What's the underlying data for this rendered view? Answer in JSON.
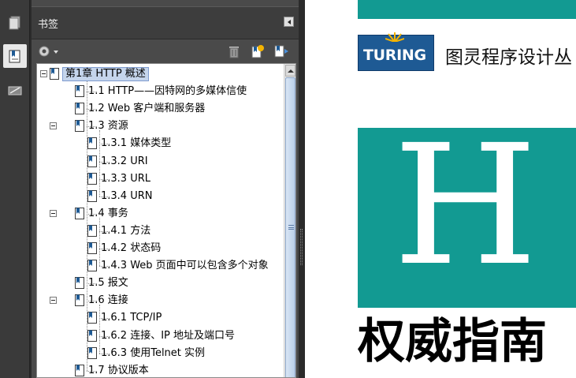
{
  "panel": {
    "title": "书签"
  },
  "toolbar": {
    "options_icon": "gear-icon",
    "delete_icon": "trash-icon",
    "new_bookmark_icon": "new-bookmark-icon",
    "expand_icon": "expand-bookmark-icon"
  },
  "bookmarks": [
    {
      "label": "第1章 HTTP 概述",
      "level": 0,
      "expanded": true,
      "selected": true
    },
    {
      "label": "1.1 HTTP——因特网的多媒体信使",
      "level": 1
    },
    {
      "label": "1.2 Web 客户端和服务器",
      "level": 1
    },
    {
      "label": "1.3 资源",
      "level": 1,
      "expanded": true
    },
    {
      "label": "1.3.1 媒体类型",
      "level": 2
    },
    {
      "label": "1.3.2 URI",
      "level": 2
    },
    {
      "label": "1.3.3 URL",
      "level": 2
    },
    {
      "label": "1.3.4 URN",
      "level": 2
    },
    {
      "label": "1.4 事务",
      "level": 1,
      "expanded": true
    },
    {
      "label": "1.4.1 方法",
      "level": 2
    },
    {
      "label": "1.4.2 状态码",
      "level": 2
    },
    {
      "label": "1.4.3 Web 页面中可以包含多个对象",
      "level": 2
    },
    {
      "label": "1.5 报文",
      "level": 1
    },
    {
      "label": "1.6 连接",
      "level": 1,
      "expanded": true
    },
    {
      "label": "1.6.1 TCP/IP",
      "level": 2
    },
    {
      "label": "1.6.2 连接、IP 地址及端口号",
      "level": 2
    },
    {
      "label": "1.6.3 使用Telnet 实例",
      "level": 2
    },
    {
      "label": "1.7 协议版本",
      "level": 1
    }
  ],
  "document": {
    "logo_text": "TURING",
    "publisher": "图灵程序设计丛",
    "cover_letter": "H",
    "subtitle": "权威指南"
  },
  "colors": {
    "accent": "#129a92",
    "logo_blue": "#1e5a94",
    "selection": "#c5d5ec"
  }
}
